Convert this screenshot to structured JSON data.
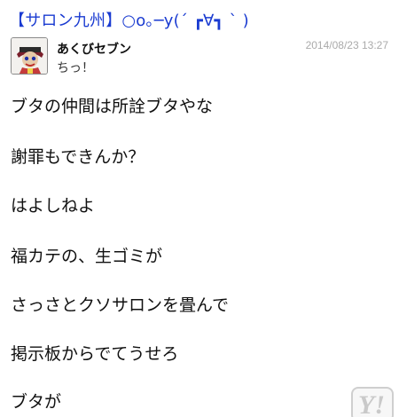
{
  "thread": {
    "title": "【サロン九州】○o｡─y(´ ┏∀┓ ` )"
  },
  "post": {
    "username": "あくびセブン",
    "timestamp": "2014/08/23 13:27",
    "subline": "ちっ！",
    "avatar": "avatar-character-icon",
    "lines": [
      "ブタの仲間は所詮ブタやな",
      "謝罪もできんか？",
      "はよしねよ",
      "福カテの、生ゴミが",
      "さっさとクソサロンを畳んで",
      "掲示板からでてうせろ",
      "ブタが"
    ]
  },
  "badge": {
    "label": "Y!",
    "icon": "yahoo-logo-icon"
  },
  "colors": {
    "title": "#1a3bd1",
    "timestamp": "#aaaaaa",
    "text": "#111111"
  }
}
